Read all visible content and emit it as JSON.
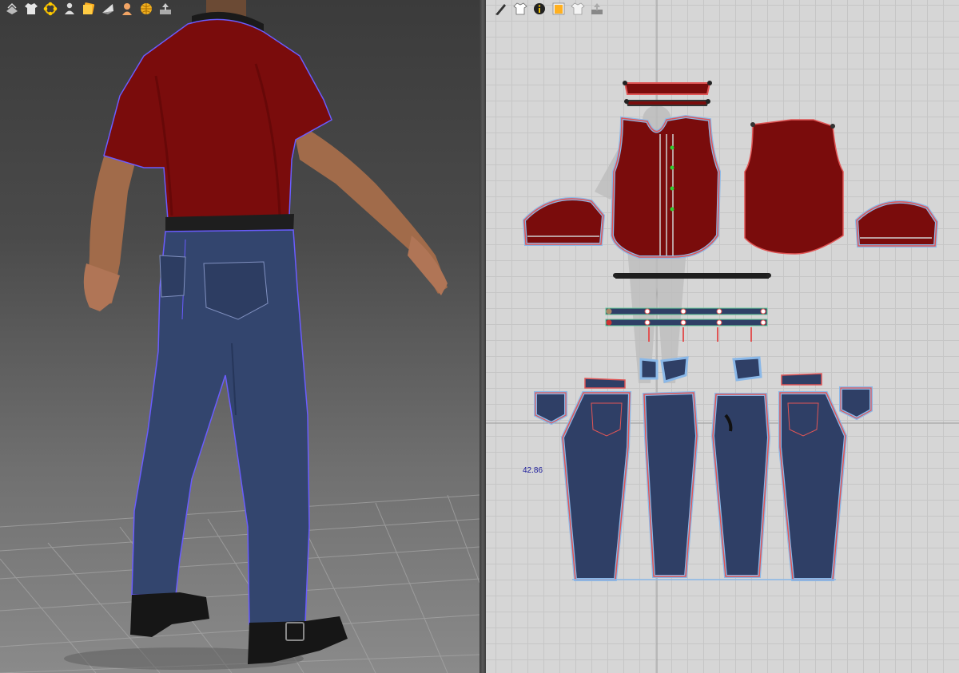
{
  "viewport_3d": {
    "toolbar": [
      {
        "name": "select-mesh-icon"
      },
      {
        "name": "garment-icon"
      },
      {
        "name": "arrangement-points-icon"
      },
      {
        "name": "avatar-icon"
      },
      {
        "name": "texture-icon"
      },
      {
        "name": "fabric-icon"
      },
      {
        "name": "skin-icon"
      },
      {
        "name": "globe-icon"
      },
      {
        "name": "export-icon"
      }
    ]
  },
  "viewport_2d": {
    "toolbar": [
      {
        "name": "pen-tool-icon"
      },
      {
        "name": "garment-2d-icon"
      },
      {
        "name": "info-icon"
      },
      {
        "name": "texture-2d-icon"
      },
      {
        "name": "shirt-white-icon"
      },
      {
        "name": "export-2d-icon"
      }
    ],
    "measure_label": "42.86"
  },
  "colors": {
    "shirt": "#7a0c0c",
    "denim": "#2f3f66",
    "pattern_outline": "#e05555",
    "selection_halo": "#8ab8e8",
    "grid_bg": "#d6d6d6"
  }
}
